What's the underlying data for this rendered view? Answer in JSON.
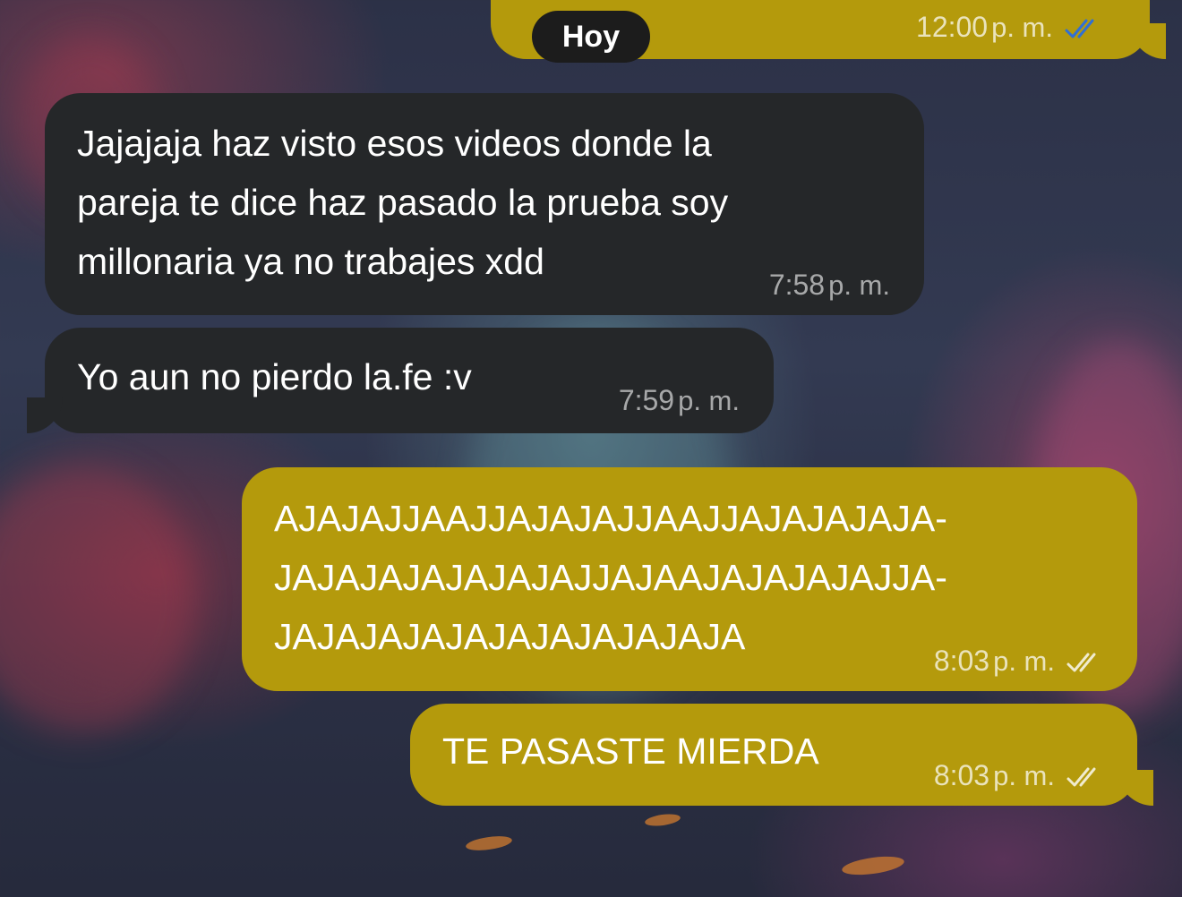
{
  "chat": {
    "date_label": "Hoy",
    "messages": [
      {
        "direction": "out",
        "text": "",
        "time": "12:00",
        "ampm": "p. m.",
        "status": "read",
        "check_color": "#2f6fd6"
      },
      {
        "direction": "in",
        "text": "Jajajaja haz visto esos videos donde la\npareja te dice haz pasado la prueba soy\nmillonaria ya no trabajes xdd",
        "time": "7:58",
        "ampm": "p. m."
      },
      {
        "direction": "in",
        "text": "Yo aun no pierdo la.fe :v",
        "time": "7:59",
        "ampm": "p. m."
      },
      {
        "direction": "out",
        "text": "AJAJAJJAAJJAJAJAJJAAJJAJAJAJAJA-\nJAJAJAJAJAJAJAJJAJAAJAJAJAJAJJA-\nJAJAJAJAJAJAJAJAJAJAJA",
        "time": "8:03",
        "ampm": "p. m.",
        "status": "delivered",
        "check_color": "#ffffff"
      },
      {
        "direction": "out",
        "text": "TE PASASTE MIERDA",
        "time": "8:03",
        "ampm": "p. m.",
        "status": "delivered",
        "check_color": "#ffffff"
      }
    ]
  },
  "colors": {
    "outgoing_bubble": "#b49a0c",
    "incoming_bubble": "#252729",
    "date_pill": "#1c1c1c"
  }
}
